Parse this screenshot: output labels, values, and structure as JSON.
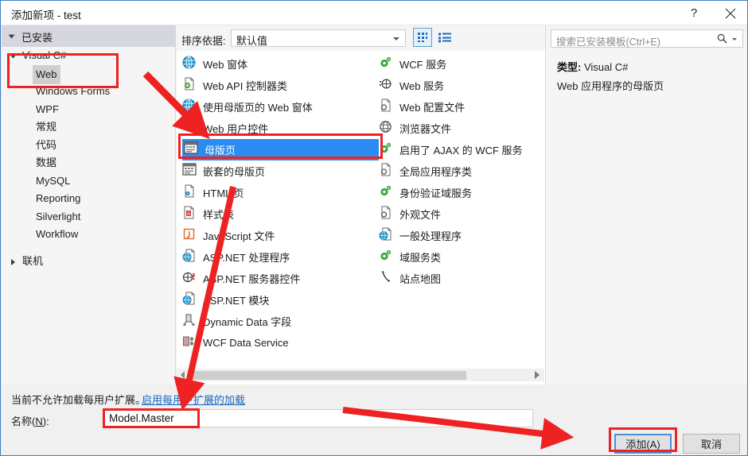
{
  "window": {
    "title": "添加新项 - test",
    "help_icon": "question-mark-icon",
    "close_icon": "close-icon"
  },
  "sidebar": {
    "header": "已安装",
    "items": [
      {
        "label": "Visual C#",
        "level": 0,
        "expanded": true,
        "selected": false
      },
      {
        "label": "Web",
        "level": 1,
        "expanded": false,
        "selected": true
      },
      {
        "label": "Windows Forms",
        "level": 1,
        "expanded": false,
        "selected": false
      },
      {
        "label": "WPF",
        "level": 1,
        "expanded": false,
        "selected": false
      },
      {
        "label": "常规",
        "level": 1,
        "expanded": false,
        "selected": false
      },
      {
        "label": "代码",
        "level": 1,
        "expanded": false,
        "selected": false
      },
      {
        "label": "数据",
        "level": 1,
        "expanded": false,
        "selected": false
      },
      {
        "label": "MySQL",
        "level": 1,
        "expanded": false,
        "selected": false
      },
      {
        "label": "Reporting",
        "level": 1,
        "expanded": false,
        "selected": false
      },
      {
        "label": "Silverlight",
        "level": 1,
        "expanded": false,
        "selected": false
      },
      {
        "label": "Workflow",
        "level": 1,
        "expanded": false,
        "selected": false
      },
      {
        "label": "联机",
        "level": 0,
        "expanded": false,
        "selected": false
      }
    ]
  },
  "toolbar": {
    "sort_label": "排序依据:",
    "sort_value": "默认值",
    "grid_view_icon": "grid-view-icon",
    "list_view_icon": "list-view-icon"
  },
  "templates": {
    "column1": [
      {
        "label": "Web 窗体",
        "icon": "globe-icon",
        "selected": false
      },
      {
        "label": "Web API 控制器类",
        "icon": "page-gear-icon",
        "selected": false
      },
      {
        "label": "使用母版页的 Web 窗体",
        "icon": "globe-icon",
        "selected": false
      },
      {
        "label": "Web 用户控件",
        "icon": "user-control-icon",
        "selected": false
      },
      {
        "label": "母版页",
        "icon": "master-page-icon",
        "selected": true
      },
      {
        "label": "嵌套的母版页",
        "icon": "master-page-icon",
        "selected": false
      },
      {
        "label": "HTML 页",
        "icon": "html-page-icon",
        "selected": false
      },
      {
        "label": "样式表",
        "icon": "stylesheet-icon",
        "selected": false
      },
      {
        "label": "JavaScript 文件",
        "icon": "javascript-icon",
        "selected": false
      },
      {
        "label": "ASP.NET 处理程序",
        "icon": "globe-page-icon",
        "selected": false
      },
      {
        "label": "ASP.NET 服务器控件",
        "icon": "server-control-icon",
        "selected": false
      },
      {
        "label": "ASP.NET 模块",
        "icon": "globe-page-icon",
        "selected": false
      },
      {
        "label": "Dynamic Data 字段",
        "icon": "data-field-icon",
        "selected": false
      },
      {
        "label": "WCF Data Service",
        "icon": "wcf-data-icon",
        "selected": false
      }
    ],
    "column2": [
      {
        "label": "WCF 服务",
        "icon": "wcf-service-icon",
        "selected": false
      },
      {
        "label": "Web 服务",
        "icon": "web-service-icon",
        "selected": false
      },
      {
        "label": "Web 配置文件",
        "icon": "config-file-icon",
        "selected": false
      },
      {
        "label": "浏览器文件",
        "icon": "browser-file-icon",
        "selected": false
      },
      {
        "label": "启用了 AJAX 的 WCF 服务",
        "icon": "wcf-service-icon",
        "selected": false
      },
      {
        "label": "全局应用程序类",
        "icon": "global-app-icon",
        "selected": false
      },
      {
        "label": "身份验证域服务",
        "icon": "wcf-service-icon",
        "selected": false
      },
      {
        "label": "外观文件",
        "icon": "skin-file-icon",
        "selected": false
      },
      {
        "label": "一般处理程序",
        "icon": "globe-page-icon",
        "selected": false
      },
      {
        "label": "域服务类",
        "icon": "wcf-service-icon",
        "selected": false
      },
      {
        "label": "站点地图",
        "icon": "sitemap-icon",
        "selected": false
      }
    ]
  },
  "search": {
    "placeholder": "搜索已安装模板(Ctrl+E)",
    "icon": "search-icon"
  },
  "details": {
    "type_label": "类型:",
    "type_value": "Visual C#",
    "description": "Web 应用程序的母版页"
  },
  "footer": {
    "extension_note": "当前不允许加载每用户扩展。",
    "extension_link": "启用每用户扩展的加载",
    "name_label": "名称(N):",
    "name_value": "Model.Master",
    "add_button": "添加(A)",
    "cancel_button": "取消"
  },
  "colors": {
    "selection_blue": "#2a8cf0",
    "annotation_red": "#ee2222",
    "link_blue": "#1668c1",
    "focus_blue": "#4a90d9"
  }
}
